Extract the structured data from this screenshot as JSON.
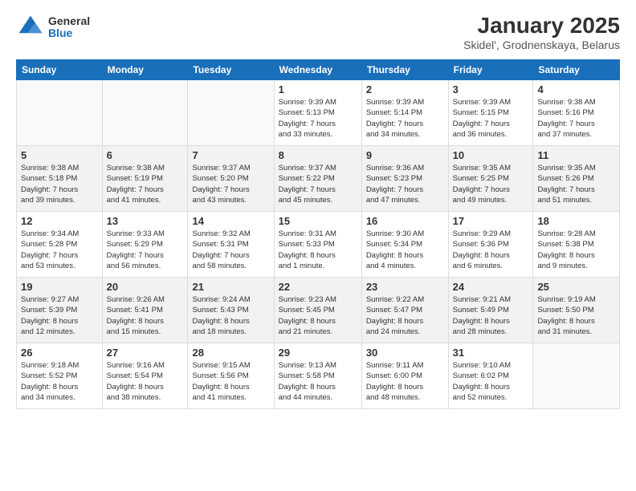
{
  "header": {
    "logo_general": "General",
    "logo_blue": "Blue",
    "title": "January 2025",
    "subtitle": "Skidel', Grodnenskaya, Belarus"
  },
  "days_of_week": [
    "Sunday",
    "Monday",
    "Tuesday",
    "Wednesday",
    "Thursday",
    "Friday",
    "Saturday"
  ],
  "weeks": [
    {
      "shaded": false,
      "days": [
        {
          "date": "",
          "info": ""
        },
        {
          "date": "",
          "info": ""
        },
        {
          "date": "",
          "info": ""
        },
        {
          "date": "1",
          "info": "Sunrise: 9:39 AM\nSunset: 5:13 PM\nDaylight: 7 hours\nand 33 minutes."
        },
        {
          "date": "2",
          "info": "Sunrise: 9:39 AM\nSunset: 5:14 PM\nDaylight: 7 hours\nand 34 minutes."
        },
        {
          "date": "3",
          "info": "Sunrise: 9:39 AM\nSunset: 5:15 PM\nDaylight: 7 hours\nand 36 minutes."
        },
        {
          "date": "4",
          "info": "Sunrise: 9:38 AM\nSunset: 5:16 PM\nDaylight: 7 hours\nand 37 minutes."
        }
      ]
    },
    {
      "shaded": true,
      "days": [
        {
          "date": "5",
          "info": "Sunrise: 9:38 AM\nSunset: 5:18 PM\nDaylight: 7 hours\nand 39 minutes."
        },
        {
          "date": "6",
          "info": "Sunrise: 9:38 AM\nSunset: 5:19 PM\nDaylight: 7 hours\nand 41 minutes."
        },
        {
          "date": "7",
          "info": "Sunrise: 9:37 AM\nSunset: 5:20 PM\nDaylight: 7 hours\nand 43 minutes."
        },
        {
          "date": "8",
          "info": "Sunrise: 9:37 AM\nSunset: 5:22 PM\nDaylight: 7 hours\nand 45 minutes."
        },
        {
          "date": "9",
          "info": "Sunrise: 9:36 AM\nSunset: 5:23 PM\nDaylight: 7 hours\nand 47 minutes."
        },
        {
          "date": "10",
          "info": "Sunrise: 9:35 AM\nSunset: 5:25 PM\nDaylight: 7 hours\nand 49 minutes."
        },
        {
          "date": "11",
          "info": "Sunrise: 9:35 AM\nSunset: 5:26 PM\nDaylight: 7 hours\nand 51 minutes."
        }
      ]
    },
    {
      "shaded": false,
      "days": [
        {
          "date": "12",
          "info": "Sunrise: 9:34 AM\nSunset: 5:28 PM\nDaylight: 7 hours\nand 53 minutes."
        },
        {
          "date": "13",
          "info": "Sunrise: 9:33 AM\nSunset: 5:29 PM\nDaylight: 7 hours\nand 56 minutes."
        },
        {
          "date": "14",
          "info": "Sunrise: 9:32 AM\nSunset: 5:31 PM\nDaylight: 7 hours\nand 58 minutes."
        },
        {
          "date": "15",
          "info": "Sunrise: 9:31 AM\nSunset: 5:33 PM\nDaylight: 8 hours\nand 1 minute."
        },
        {
          "date": "16",
          "info": "Sunrise: 9:30 AM\nSunset: 5:34 PM\nDaylight: 8 hours\nand 4 minutes."
        },
        {
          "date": "17",
          "info": "Sunrise: 9:29 AM\nSunset: 5:36 PM\nDaylight: 8 hours\nand 6 minutes."
        },
        {
          "date": "18",
          "info": "Sunrise: 9:28 AM\nSunset: 5:38 PM\nDaylight: 8 hours\nand 9 minutes."
        }
      ]
    },
    {
      "shaded": true,
      "days": [
        {
          "date": "19",
          "info": "Sunrise: 9:27 AM\nSunset: 5:39 PM\nDaylight: 8 hours\nand 12 minutes."
        },
        {
          "date": "20",
          "info": "Sunrise: 9:26 AM\nSunset: 5:41 PM\nDaylight: 8 hours\nand 15 minutes."
        },
        {
          "date": "21",
          "info": "Sunrise: 9:24 AM\nSunset: 5:43 PM\nDaylight: 8 hours\nand 18 minutes."
        },
        {
          "date": "22",
          "info": "Sunrise: 9:23 AM\nSunset: 5:45 PM\nDaylight: 8 hours\nand 21 minutes."
        },
        {
          "date": "23",
          "info": "Sunrise: 9:22 AM\nSunset: 5:47 PM\nDaylight: 8 hours\nand 24 minutes."
        },
        {
          "date": "24",
          "info": "Sunrise: 9:21 AM\nSunset: 5:49 PM\nDaylight: 8 hours\nand 28 minutes."
        },
        {
          "date": "25",
          "info": "Sunrise: 9:19 AM\nSunset: 5:50 PM\nDaylight: 8 hours\nand 31 minutes."
        }
      ]
    },
    {
      "shaded": false,
      "days": [
        {
          "date": "26",
          "info": "Sunrise: 9:18 AM\nSunset: 5:52 PM\nDaylight: 8 hours\nand 34 minutes."
        },
        {
          "date": "27",
          "info": "Sunrise: 9:16 AM\nSunset: 5:54 PM\nDaylight: 8 hours\nand 38 minutes."
        },
        {
          "date": "28",
          "info": "Sunrise: 9:15 AM\nSunset: 5:56 PM\nDaylight: 8 hours\nand 41 minutes."
        },
        {
          "date": "29",
          "info": "Sunrise: 9:13 AM\nSunset: 5:58 PM\nDaylight: 8 hours\nand 44 minutes."
        },
        {
          "date": "30",
          "info": "Sunrise: 9:11 AM\nSunset: 6:00 PM\nDaylight: 8 hours\nand 48 minutes."
        },
        {
          "date": "31",
          "info": "Sunrise: 9:10 AM\nSunset: 6:02 PM\nDaylight: 8 hours\nand 52 minutes."
        },
        {
          "date": "",
          "info": ""
        }
      ]
    }
  ]
}
